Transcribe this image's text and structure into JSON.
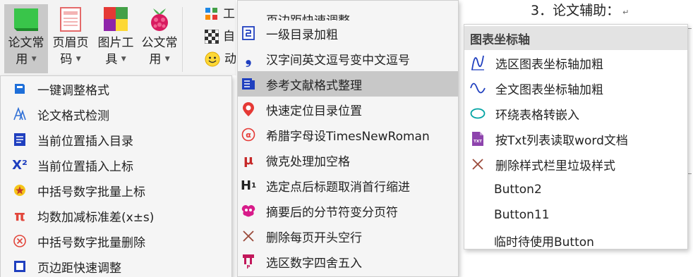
{
  "ribbon": {
    "paper_btn": {
      "line1": "论文常",
      "line2": "用"
    },
    "header_btn": {
      "line1": "页眉页",
      "line2": "码"
    },
    "picture_btn": {
      "line1": "图片工",
      "line2": "具"
    },
    "official_btn": {
      "line1": "公文常",
      "line2": "用"
    },
    "small_items": [
      "工",
      "自",
      "动"
    ]
  },
  "document": {
    "text": "3．论文辅助："
  },
  "menu1": {
    "items": [
      {
        "label": "一键调整格式",
        "icon": "doc-adjust-icon"
      },
      {
        "label": "论文格式检测",
        "icon": "format-check-icon"
      },
      {
        "label": "当前位置插入目录",
        "icon": "toc-icon"
      },
      {
        "label": "当前位置插入上标",
        "icon": "superscript-icon"
      },
      {
        "label": "中括号数字批量上标",
        "icon": "star-icon"
      },
      {
        "label": "均数加减标准差(x±s)",
        "icon": "pi-icon"
      },
      {
        "label": "中括号数字批量删除",
        "icon": "circle-x-icon"
      },
      {
        "label": "页边距快速调整",
        "icon": "margin-icon"
      }
    ]
  },
  "menu2": {
    "items": [
      {
        "label": "页边距快速调整",
        "icon": "margin-icon"
      },
      {
        "label": "一级目录加粗",
        "icon": "heading-bold-icon"
      },
      {
        "label": "汉字间英文逗号变中文逗号",
        "icon": "comma-icon"
      },
      {
        "label": "参考文献格式整理",
        "icon": "reference-icon"
      },
      {
        "label": "快速定位目录位置",
        "icon": "location-pin-icon"
      },
      {
        "label": "希腊字母设TimesNewRoman",
        "icon": "alpha-icon"
      },
      {
        "label": "微克处理加空格",
        "icon": "mu-icon"
      },
      {
        "label": "选定点后标题取消首行缩进",
        "icon": "heading-icon"
      },
      {
        "label": "摘要后的分节符变分页符",
        "icon": "section-break-icon"
      },
      {
        "label": "删除每页开头空行",
        "icon": "delete-x-icon"
      },
      {
        "label": "选区数字四舍五入",
        "icon": "round-number-icon"
      }
    ]
  },
  "menu3": {
    "title": "图表坐标轴",
    "items": [
      {
        "label": "选区图表坐标轴加粗",
        "icon": "axis-bold-icon"
      },
      {
        "label": "全文图表坐标轴加粗",
        "icon": "wave-icon"
      },
      {
        "label": "环绕表格转嵌入",
        "icon": "ellipse-icon"
      },
      {
        "label": "按Txt列表读取word文档",
        "icon": "txt-file-icon"
      },
      {
        "label": "删除样式栏里垃圾样式",
        "icon": "delete-x-icon"
      },
      {
        "label": "Button2",
        "icon": ""
      },
      {
        "label": "Button11",
        "icon": ""
      },
      {
        "label": "临时待使用Button",
        "icon": ""
      }
    ]
  },
  "colors": {
    "menu_bg": "#f5f5f5",
    "highlight": "#c8c8c8",
    "ribbon_active": "#c9c9c9",
    "accent_blue": "#1f4fbf",
    "accent_red": "#c62828"
  }
}
